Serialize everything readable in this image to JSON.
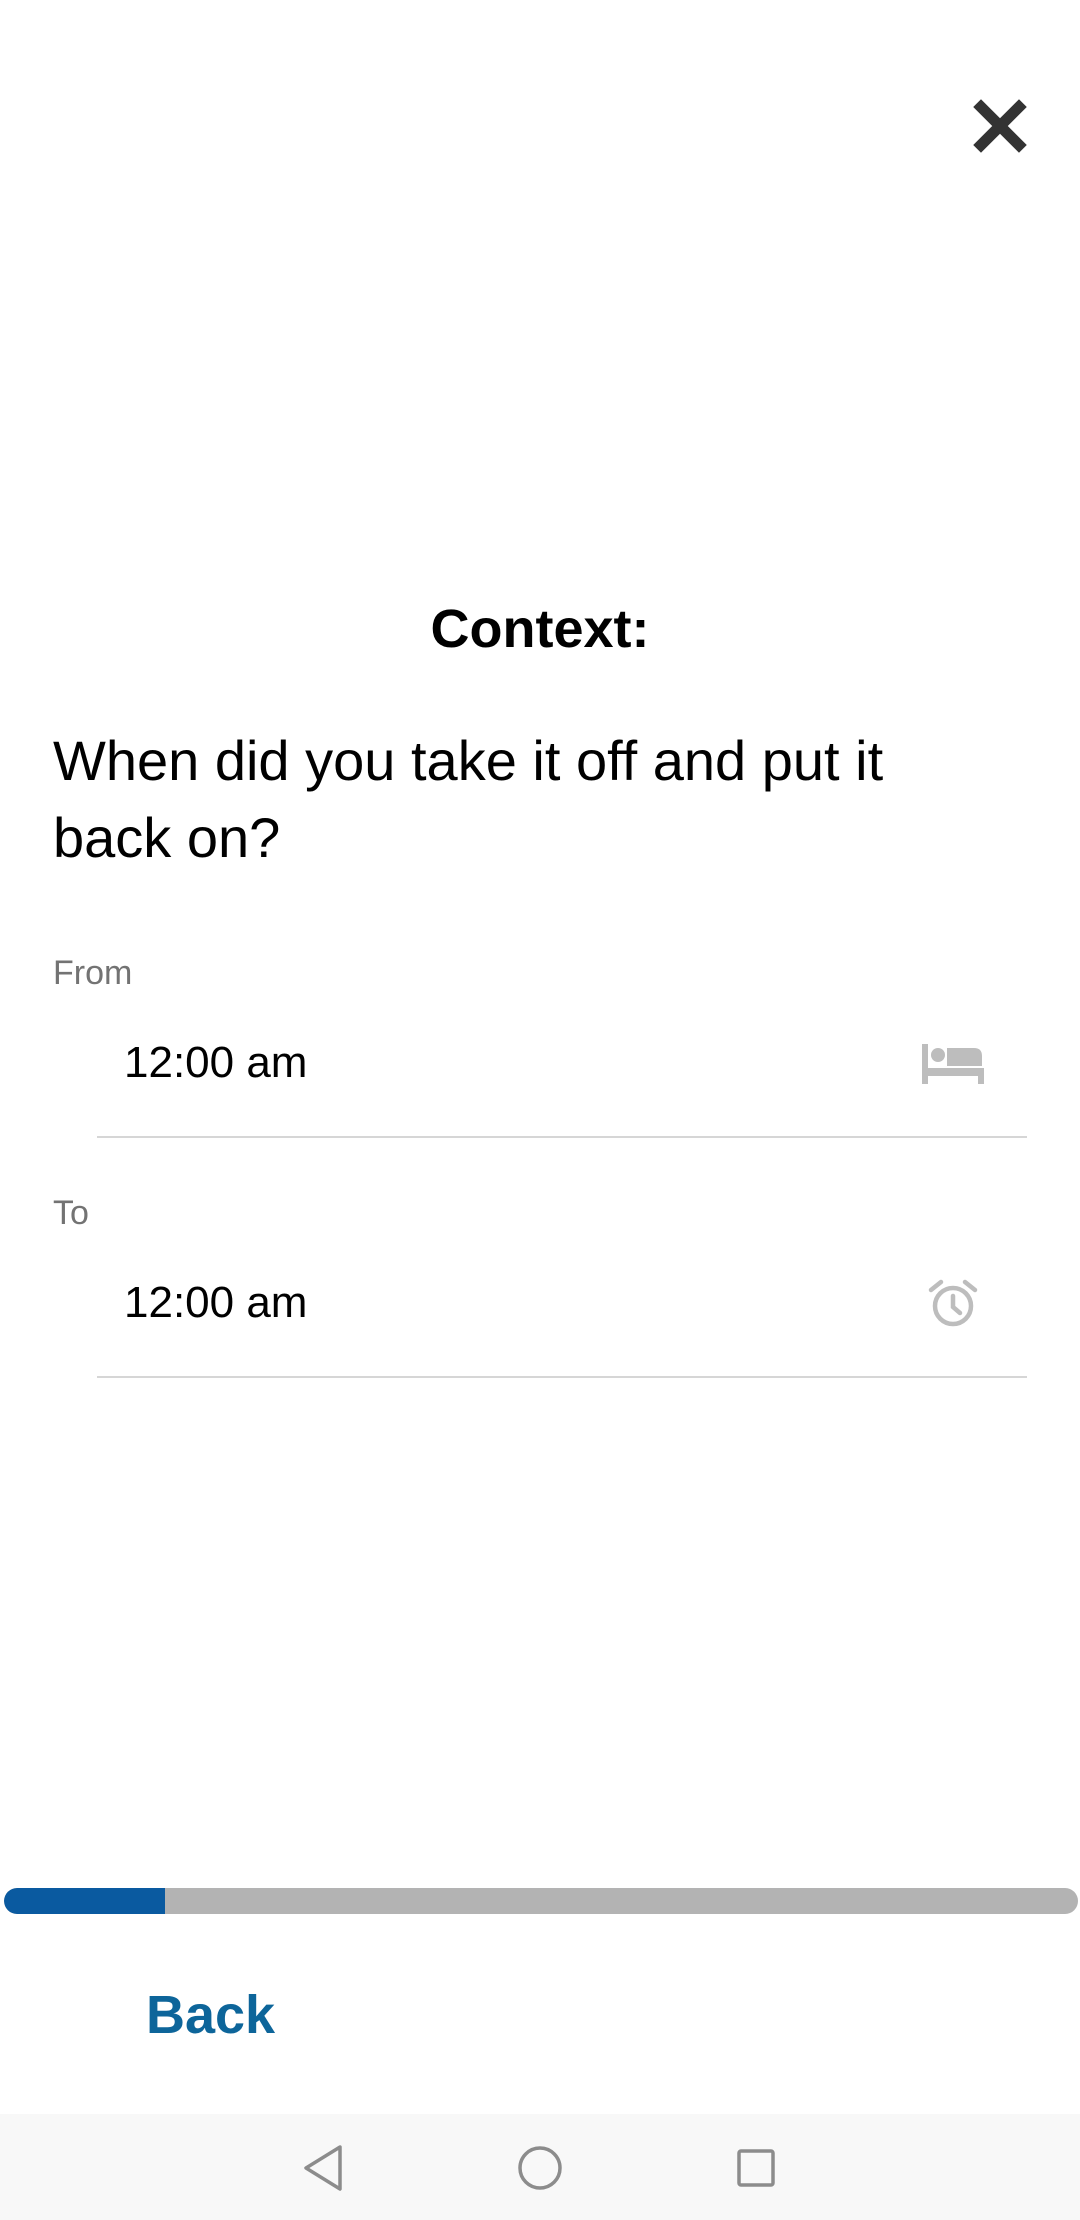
{
  "dialog": {
    "close_icon": "close-icon",
    "heading": "Context:",
    "question": "When did you take it off and put it back on?"
  },
  "from_field": {
    "label": "From",
    "value": "12:00 am",
    "icon": "bed-icon"
  },
  "to_field": {
    "label": "To",
    "value": "12:00 am",
    "icon": "alarm-clock-icon"
  },
  "progress": {
    "fraction": 0.15,
    "fill_color": "#0a5aa0",
    "track_color": "#b3b3b3"
  },
  "footer": {
    "back_label": "Back",
    "accent_color": "#0d659a"
  },
  "nav_bar": {
    "icons": [
      "back-triangle-icon",
      "home-circle-icon",
      "recents-square-icon"
    ]
  }
}
